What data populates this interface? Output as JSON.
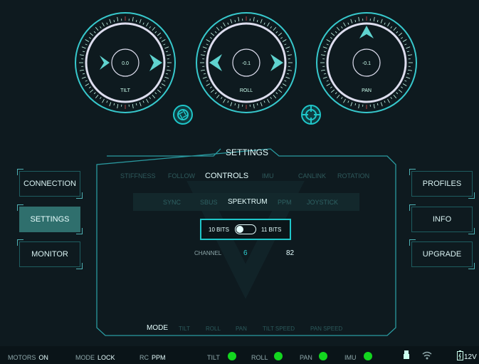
{
  "dials": {
    "tilt": {
      "label": "TILT",
      "value": "0.0"
    },
    "roll": {
      "label": "ROLL",
      "value": "-0.1"
    },
    "pan": {
      "label": "PAN",
      "value": "-0.1"
    }
  },
  "panel": {
    "title": "SETTINGS"
  },
  "left_nav": [
    {
      "label": "CONNECTION",
      "active": false
    },
    {
      "label": "SETTINGS",
      "active": true
    },
    {
      "label": "MONITOR",
      "active": false
    }
  ],
  "right_nav": [
    {
      "label": "PROFILES"
    },
    {
      "label": "INFO"
    },
    {
      "label": "UPGRADE"
    }
  ],
  "tabs": [
    {
      "label": "STIFFNESS",
      "active": false
    },
    {
      "label": "FOLLOW",
      "active": false
    },
    {
      "label": "CONTROLS",
      "active": true
    },
    {
      "label": "IMU",
      "active": false
    },
    {
      "label": "CANLINK",
      "active": false
    },
    {
      "label": "ROTATION",
      "active": false
    }
  ],
  "subtabs": [
    {
      "label": "SYNC",
      "active": false
    },
    {
      "label": "SBUS",
      "active": false
    },
    {
      "label": "SPEKTRUM",
      "active": true
    },
    {
      "label": "PPM",
      "active": false
    },
    {
      "label": "JOYSTICK",
      "active": false
    }
  ],
  "bits_toggle": {
    "left": "10 BITS",
    "right": "11 BITS"
  },
  "channel": {
    "label": "CHANNEL",
    "number": "6",
    "value": "82"
  },
  "bottom_tabs": [
    {
      "label": "MODE",
      "active": true
    },
    {
      "label": "TILT",
      "active": false
    },
    {
      "label": "ROLL",
      "active": false
    },
    {
      "label": "PAN",
      "active": false
    },
    {
      "label": "TILT SPEED",
      "active": false
    },
    {
      "label": "PAN SPEED",
      "active": false
    }
  ],
  "status_bar": {
    "motors_key": "MOTORS",
    "motors_val": "ON",
    "mode_key": "MODE",
    "mode_val": "LOCK",
    "rc_key": "RC",
    "rc_val": "PPM",
    "tilt": "TILT",
    "roll": "ROLL",
    "pan": "PAN",
    "imu": "IMU",
    "battery": "12V"
  },
  "colors": {
    "accent": "#1fc6c9",
    "status_ok": "#13d61f",
    "active_bg": "#2f6f6d"
  }
}
